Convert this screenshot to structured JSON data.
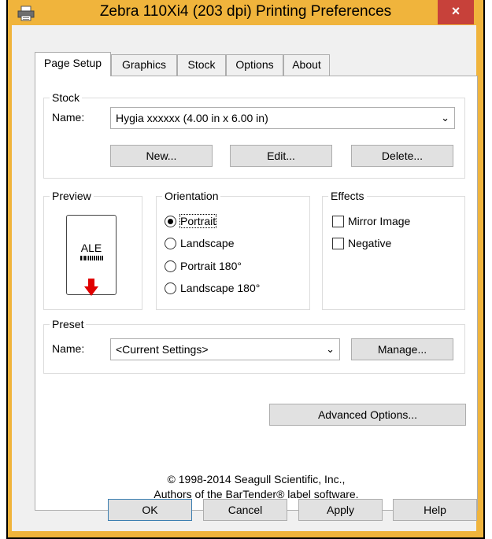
{
  "window": {
    "title": "Zebra 110Xi4 (203 dpi) Printing Preferences",
    "close_glyph": "×"
  },
  "tabs": [
    {
      "label": "Page Setup",
      "active": true
    },
    {
      "label": "Graphics",
      "active": false
    },
    {
      "label": "Stock",
      "active": false
    },
    {
      "label": "Options",
      "active": false
    },
    {
      "label": "About",
      "active": false
    }
  ],
  "stock": {
    "group_title": "Stock",
    "name_label": "Name:",
    "name_value": "Hygia xxxxxx (4.00 in x 6.00 in)",
    "new_button": "New...",
    "edit_button": "Edit...",
    "delete_button": "Delete..."
  },
  "preview": {
    "group_title": "Preview",
    "label_text": "ALE"
  },
  "orientation": {
    "group_title": "Orientation",
    "options": [
      {
        "label": "Portrait",
        "selected": true
      },
      {
        "label": "Landscape",
        "selected": false
      },
      {
        "label": "Portrait 180°",
        "selected": false
      },
      {
        "label": "Landscape 180°",
        "selected": false
      }
    ]
  },
  "effects": {
    "group_title": "Effects",
    "options": [
      {
        "label": "Mirror Image",
        "checked": false
      },
      {
        "label": "Negative",
        "checked": false
      }
    ]
  },
  "preset": {
    "group_title": "Preset",
    "name_label": "Name:",
    "name_value": "<Current Settings>",
    "manage_button": "Manage..."
  },
  "advanced_button": "Advanced Options...",
  "copyright": {
    "line1": "1998-2014 Seagull Scientific, Inc.,",
    "line2": "Authors of the BarTender",
    "line2_suffix": " label software."
  },
  "buttons": {
    "ok": "OK",
    "cancel": "Cancel",
    "apply": "Apply",
    "help": "Help"
  },
  "colors": {
    "frame": "#f0b43c",
    "close": "#c7413a",
    "arrow": "#e00000"
  }
}
